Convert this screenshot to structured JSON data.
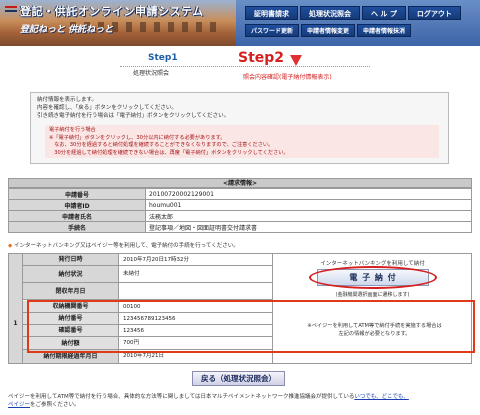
{
  "header": {
    "title": "登記・供託オンライン申請システム",
    "subtitle": "登記ねっと 供託ねっと",
    "nav_top": [
      "証明書請求",
      "処理状況照会",
      "ヘ ル プ",
      "ログアウト"
    ],
    "nav_bottom": [
      "パスワード更新",
      "申請者情報変更",
      "申請者情報抹消"
    ]
  },
  "steps": {
    "step1_label": "Step1",
    "step1_sub": "処理状況照会",
    "step2_label": "Step2",
    "step2_sub": "照会内容確認(電子納付情報表示)"
  },
  "notice": {
    "lines": [
      "納付情報を表示します。",
      "内容を確認し、「戻る」ボタンをクリックしてください。",
      "引き続き電子納付を行う場合は「電子納付」ボタンをクリックしてください。"
    ],
    "warn_lines": [
      "電子納付を行う場合",
      "※「電子納付」ボタンをクリックし、30分以内に納付する必要があります。",
      "　なお、30分を経過すると納付処理を継続することができなくなりますので、ご注意ください。",
      "　30分を経過して納付処理を継続できない場合は、再度「電子納付」ボタンをクリックしてください。"
    ]
  },
  "request_info": {
    "section_title": "<請求情報>",
    "rows": [
      {
        "label": "申請番号",
        "value": "20100720002129001"
      },
      {
        "label": "申請者ID",
        "value": "houmu001"
      },
      {
        "label": "申請者氏名",
        "value": "法務太郎"
      },
      {
        "label": "手続名",
        "value": "登記事項／地図・図面証明書交付請求書"
      }
    ]
  },
  "bullet_note": "インターネットバンキング又はペイジー等を利用して、電子納付の手続を行ってください。",
  "payment": {
    "number": "1",
    "rows": [
      {
        "label": "発行日時",
        "value": "2010年7月20日17時32分"
      },
      {
        "label": "納付状況",
        "value": "未納付"
      },
      {
        "label": "閉収年月日",
        "value": ""
      },
      {
        "label": "収納機関番号",
        "value": "00100"
      },
      {
        "label": "納付番号",
        "value": "123456789123456"
      },
      {
        "label": "確認番号",
        "value": "123456"
      },
      {
        "label": "納付額",
        "value": "700円"
      },
      {
        "label": "納付期限経過年月日",
        "value": "2010年7月21日"
      }
    ],
    "right_title": "インターネットバンキングを利用して納付",
    "epay_button": "電 子 納 付",
    "right_note": "(金融機関選択画面に遷移します)",
    "atm_note_1": "※ペイジーを利用してATM等で納付手続を実施する場合は",
    "atm_note_2": "左記の情報が必要となります。"
  },
  "back_button": "戻る（処理状況照会）",
  "footer": {
    "text_1": "ペイジーを利用してATM等で納付を行う場合、具体的な方法等に関しましては日本マルチペイメントネットワーク推進協議会が提供している",
    "link_1": "いつでも、どこでも、",
    "link_2": "ペイジー",
    "text_2": "をご参照ください。"
  }
}
